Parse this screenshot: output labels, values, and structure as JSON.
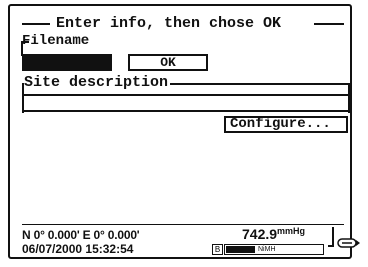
{
  "dialog": {
    "title": "Enter info, then chose OK"
  },
  "filename": {
    "label": "Filename",
    "value": "",
    "ok_label": "OK"
  },
  "site": {
    "label": "Site description",
    "value": ""
  },
  "configure": {
    "label": "Configure..."
  },
  "status": {
    "coordinates": "N 0° 0.000' E 0° 0.000'",
    "datetime": "06/07/2000 15:32:54",
    "pressure_value": "742.9",
    "pressure_unit": "mmHg",
    "battery_type": "NiMH",
    "battery_level": 0.3,
    "battery_icon_glyph": "B"
  },
  "colors": {
    "foreground": "#111111",
    "background": "#ffffff"
  }
}
